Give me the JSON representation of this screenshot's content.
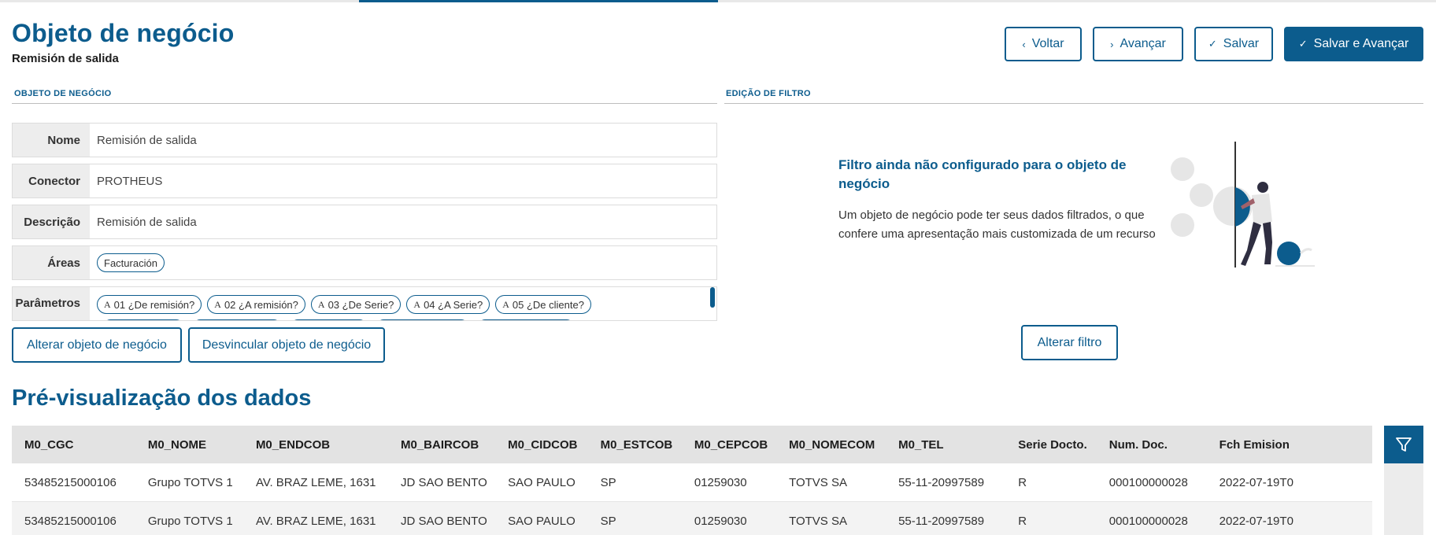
{
  "header": {
    "title": "Objeto de negócio",
    "subtitle": "Remisión de salida"
  },
  "actions": {
    "back": "Voltar",
    "next": "Avançar",
    "save": "Salvar",
    "save_next": "Salvar e Avançar"
  },
  "business_object": {
    "section_label": "OBJETO DE NEGÓCIO",
    "fields": {
      "nome_label": "Nome",
      "nome_value": "Remisión de salida",
      "conector_label": "Conector",
      "conector_value": "PROTHEUS",
      "descricao_label": "Descrição",
      "descricao_value": "Remisión de salida",
      "areas_label": "Áreas",
      "parametros_label": "Parâmetros"
    },
    "areas": [
      "Facturación"
    ],
    "parameters": [
      {
        "type": "A",
        "label": "01 ¿De remisión?"
      },
      {
        "type": "A",
        "label": "02 ¿A remisión?"
      },
      {
        "type": "A",
        "label": "03 ¿De Serie?"
      },
      {
        "type": "A",
        "label": "04 ¿A Serie?"
      },
      {
        "type": "A",
        "label": "05 ¿De cliente?"
      }
    ],
    "alter_button": "Alterar objeto de negócio",
    "unlink_button": "Desvincular objeto de negócio"
  },
  "filter": {
    "section_label": "EDIÇÃO DE FILTRO",
    "empty_title": "Filtro ainda não configurado para o objeto de negócio",
    "empty_text": "Um objeto de negócio pode ter seus dados filtrados, o que confere uma apresentação mais customizada de um recurso",
    "alter_button": "Alterar filtro",
    "illustration_icon": "person-with-balls-illustration"
  },
  "preview": {
    "title": "Pré-visualização dos dados",
    "columns": [
      "M0_CGC",
      "M0_NOME",
      "M0_ENDCOB",
      "M0_BAIRCOB",
      "M0_CIDCOB",
      "M0_ESTCOB",
      "M0_CEPCOB",
      "M0_NOMECOM",
      "M0_TEL",
      "Serie Docto.",
      "Num. Doc.",
      "Fch Emision"
    ],
    "rows": [
      [
        "53485215000106",
        "Grupo TOTVS 1",
        "AV. BRAZ LEME, 1631",
        "JD SAO BENTO",
        "SAO PAULO",
        "SP",
        "01259030",
        "TOTVS SA",
        "55-11-20997589",
        "R",
        "000100000028",
        "2022-07-19T0"
      ],
      [
        "53485215000106",
        "Grupo TOTVS 1",
        "AV. BRAZ LEME, 1631",
        "JD SAO BENTO",
        "SAO PAULO",
        "SP",
        "01259030",
        "TOTVS SA",
        "55-11-20997589",
        "R",
        "000100000028",
        "2022-07-19T0"
      ]
    ],
    "filter_icon": "funnel-icon"
  },
  "colors": {
    "primary": "#0c5c8d",
    "label_bg": "#ededed",
    "table_header_bg": "#e3e3e3"
  }
}
